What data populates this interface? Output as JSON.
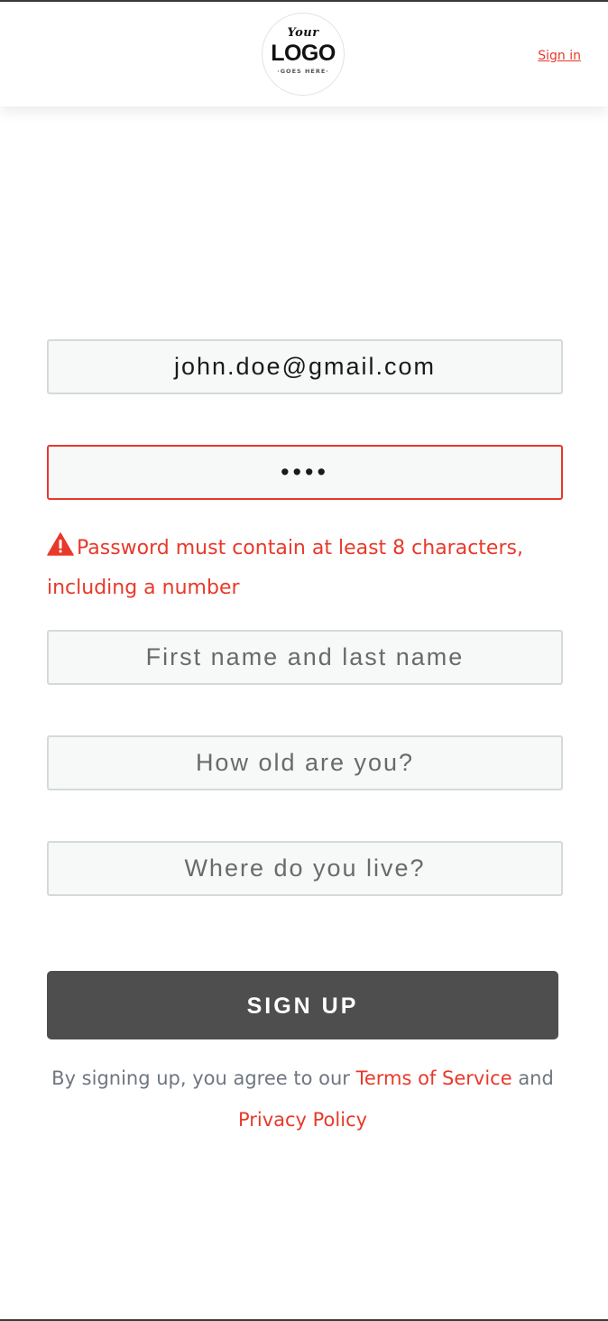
{
  "header": {
    "logo_small": "Your",
    "logo_big": "LOGO",
    "logo_tagline": "·GOES HERE·",
    "signin_label": "Sign in"
  },
  "form": {
    "email_value": "john.doe@gmail.com",
    "password_value": "••••",
    "password_error": "Password must contain at least 8 characters, including a number",
    "name_placeholder": "First name and last name",
    "age_placeholder": "How old are you?",
    "city_placeholder": "Where do you live?",
    "submit_label": "SIGN UP"
  },
  "legal": {
    "prefix": "By signing up, you agree to our ",
    "terms_label": "Terms of Service",
    "middle": " and ",
    "privacy_label": "Privacy Policy"
  },
  "icons": {
    "error": "warning-triangle-icon"
  },
  "colors": {
    "accent": "#e8392a",
    "button": "#4e4e4e",
    "field_bg": "#f7f8f8",
    "field_border": "#d6d9dc",
    "muted_text": "#6f7680"
  }
}
